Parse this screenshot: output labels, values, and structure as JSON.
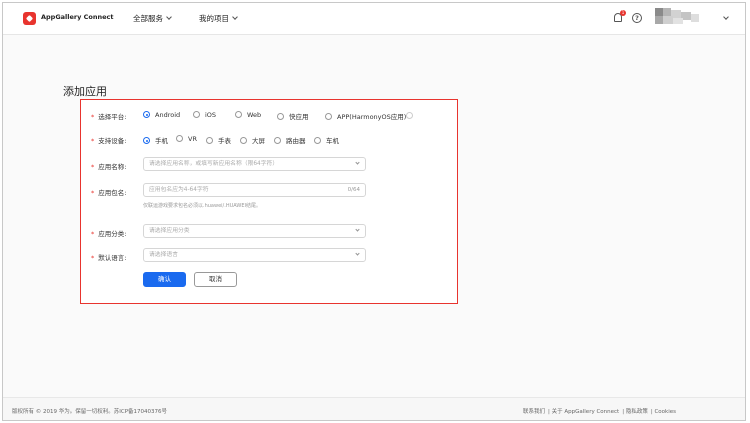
{
  "header": {
    "brand": "AppGallery Connect",
    "nav": [
      {
        "label": "全部服务"
      },
      {
        "label": "我的项目"
      }
    ],
    "notification_count": "1",
    "help_symbol": "?",
    "colors": {
      "brand": "#e8342e"
    }
  },
  "page": {
    "title": "添加应用"
  },
  "form": {
    "required_mark": "*",
    "platform": {
      "label": "选择平台:",
      "options": [
        "Android",
        "iOS",
        "Web",
        "快应用",
        "APP(HarmonyOS应用)"
      ],
      "selected": "Android"
    },
    "device": {
      "label": "支持设备:",
      "options": [
        "手机",
        "VR",
        "手表",
        "大屏",
        "路由器",
        "车机"
      ],
      "selected": "手机"
    },
    "app_name": {
      "label": "应用名称:",
      "placeholder": "请选择应用名称，或填写新应用名称（限64字符）"
    },
    "package_name": {
      "label": "应用包名:",
      "placeholder": "应用包名应为4-64字符",
      "counter": "0/64",
      "hint": "仅联运游戏要求包名必须以.huawei/.HUAWEI结尾。"
    },
    "category": {
      "label": "应用分类:",
      "placeholder": "请选择应用分类"
    },
    "language": {
      "label": "默认语言:",
      "placeholder": "请选择语言"
    },
    "confirm_label": "确认",
    "cancel_label": "取消",
    "colors": {
      "accent": "#1a6aef",
      "highlight_border": "#e8342e"
    }
  },
  "footer": {
    "copyright": "版权所有 © 2019 华为。保留一切权利。苏ICP备17040376号",
    "links": [
      "联系我们",
      "关于 AppGallery Connect",
      "隐私政策",
      "Cookies"
    ]
  }
}
